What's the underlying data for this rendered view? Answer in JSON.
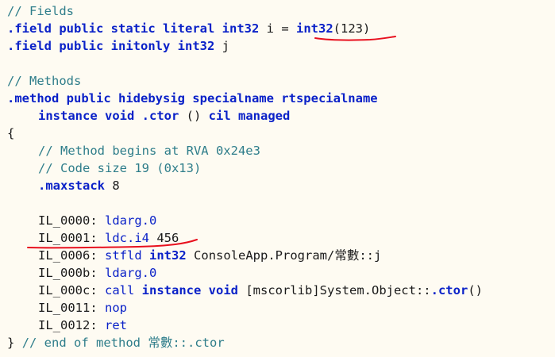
{
  "code": {
    "comment_fields": "// Fields",
    "field1": {
      "directive": ".field",
      "modifiers": "public static literal",
      "type": "int32",
      "name": " i = ",
      "init_type": "int32",
      "init_value": "(123)"
    },
    "field2": {
      "directive": ".field",
      "modifiers": "public initonly",
      "type": "int32",
      "name": " j"
    },
    "comment_methods": "// Methods",
    "method_decl": {
      "directive": ".method",
      "modifiers": "public hidebysig specialname rtspecialname"
    },
    "method_sig": {
      "instance": "instance",
      "void": "void",
      "ctor": ".ctor",
      "parens": " () ",
      "cil": "cil managed"
    },
    "open_brace": "{",
    "comment_rva": "// Method begins at RVA 0x24e3",
    "comment_size": "// Code size 19 (0x13)",
    "maxstack": {
      "directive": ".maxstack",
      "value": " 8"
    },
    "il": [
      {
        "label": "IL_0000:",
        "opcode": "ldarg.0",
        "rest": ""
      },
      {
        "label": "IL_0001:",
        "opcode": "ldc.i4",
        "rest": " 456"
      },
      {
        "label": "IL_0006:",
        "opcode": "stfld",
        "type": "int32",
        "rest": "ConsoleApp.Program/常數::j"
      },
      {
        "label": "IL_000b:",
        "opcode": "ldarg.0",
        "rest": ""
      },
      {
        "label": "IL_000c:",
        "opcode": "call",
        "instance": "instance",
        "void": "void",
        "rest_pre": "[mscorlib]System.Object::",
        "ctor": ".ctor",
        "rest_post": "()"
      },
      {
        "label": "IL_0011:",
        "opcode": "nop",
        "rest": ""
      },
      {
        "label": "IL_0012:",
        "opcode": "ret",
        "rest": ""
      }
    ],
    "close_brace": "}",
    "comment_end": "// end of method 常數::.ctor"
  },
  "annotation_color": "#e8101e"
}
